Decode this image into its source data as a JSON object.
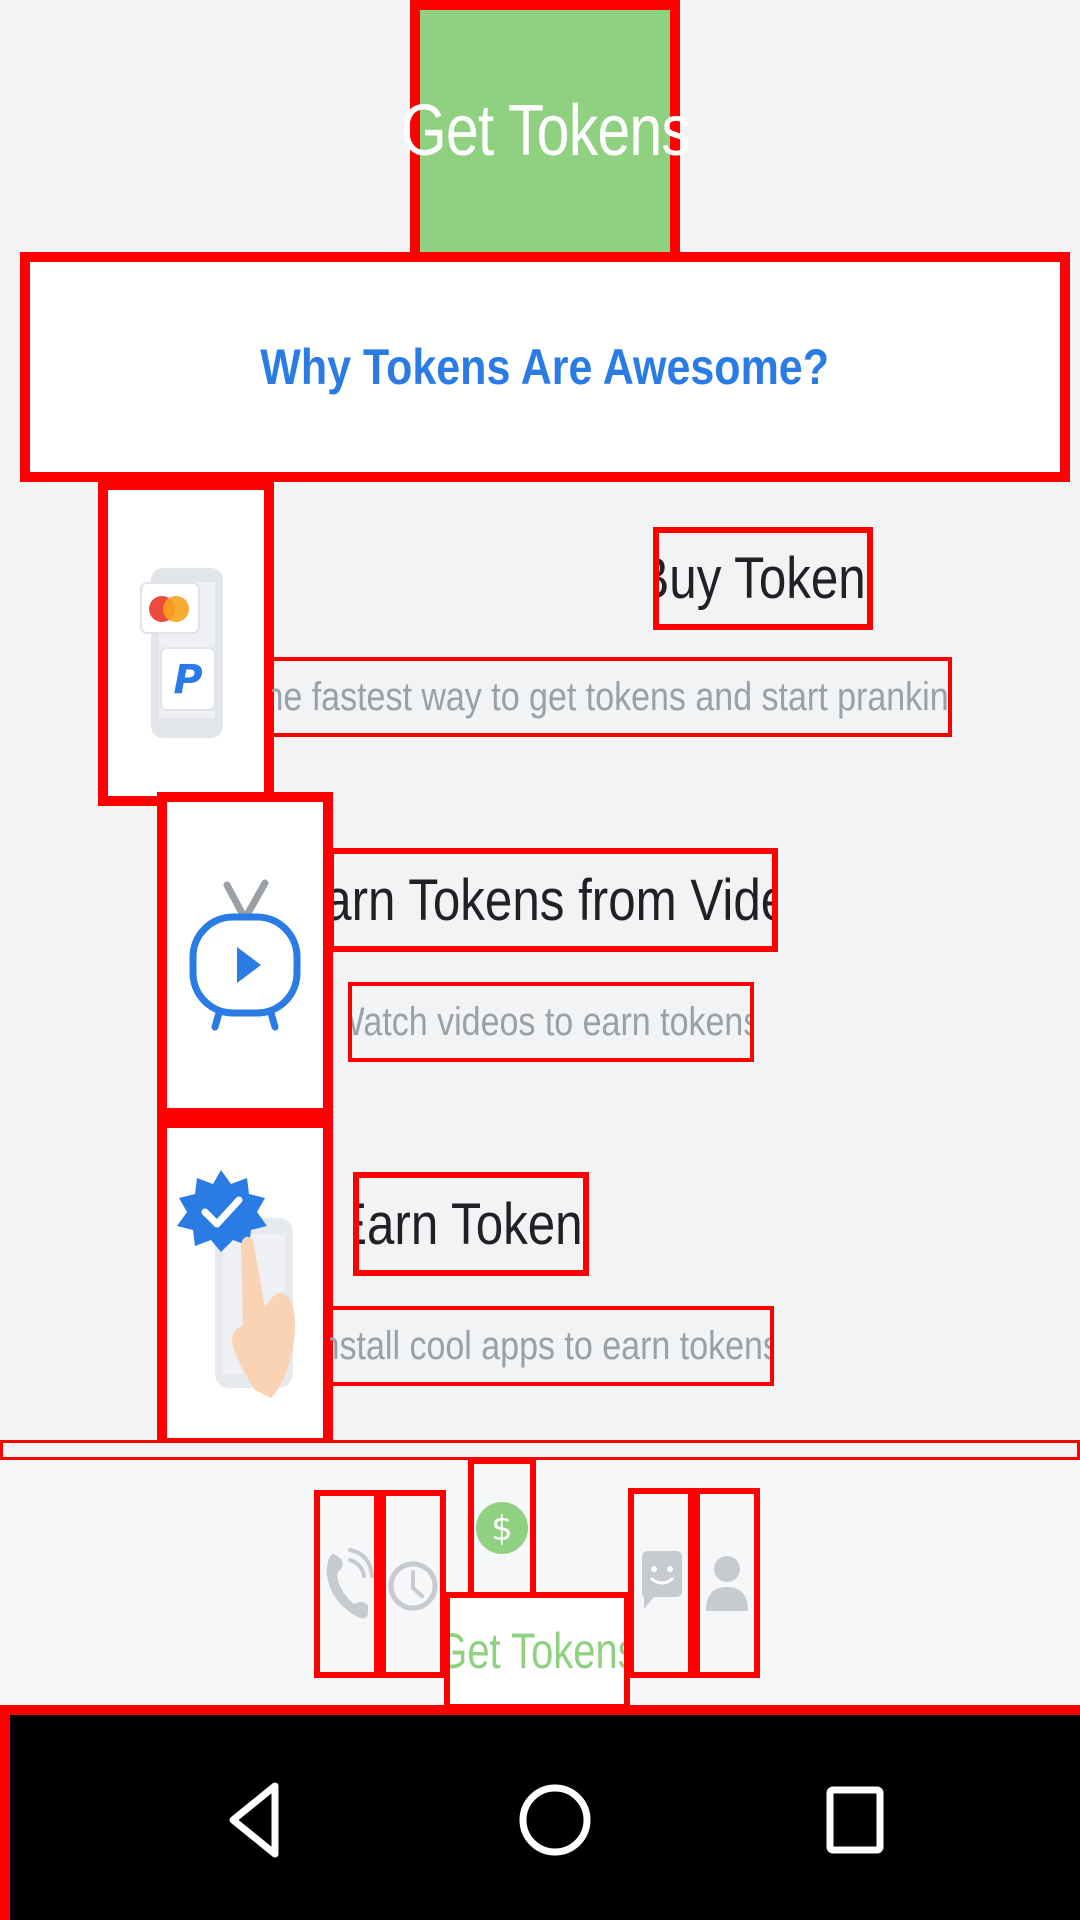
{
  "header": {
    "title": "Get Tokens"
  },
  "banner": {
    "text": "Why Tokens Are Awesome?"
  },
  "features": [
    {
      "icon": "payment-phone-icon",
      "title": "Buy Tokens",
      "description": "The fastest way to get tokens and start pranking."
    },
    {
      "icon": "tv-play-icon",
      "title": "Earn Tokens from Video",
      "description": "Watch videos to earn tokens."
    },
    {
      "icon": "verified-badge-tap-icon",
      "title": "Earn Tokens",
      "description": "Install cool apps to earn tokens."
    }
  ],
  "tabbar": {
    "items": [
      {
        "icon": "phone-icon",
        "active": false
      },
      {
        "icon": "clock-icon",
        "active": false
      },
      {
        "icon": "dollar-coin-icon",
        "active": true,
        "label": "Get Tokens"
      },
      {
        "icon": "chat-icon",
        "active": false
      },
      {
        "icon": "person-icon",
        "active": false
      }
    ]
  },
  "system_nav": {
    "buttons": [
      "back-icon",
      "home-icon",
      "recents-icon"
    ]
  },
  "colors": {
    "accent_green": "#8fd081",
    "accent_blue": "#2a7be4",
    "annotation_red": "#ff0000",
    "muted_icon": "#c7cbd0"
  }
}
